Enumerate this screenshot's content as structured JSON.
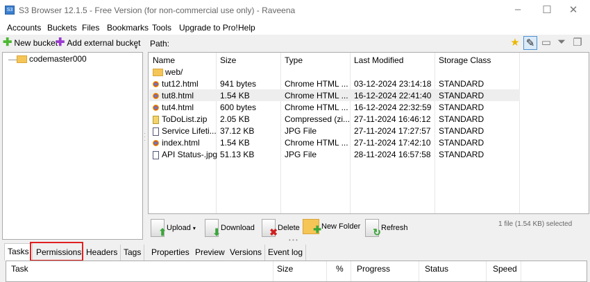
{
  "window": {
    "title": "S3 Browser 12.1.5 - Free Version (for non-commercial use only) - Raveena",
    "icon_text": "S3"
  },
  "menu": [
    "Accounts",
    "Buckets",
    "Files",
    "Bookmarks",
    "Tools",
    "Upgrade to Pro!",
    "Help"
  ],
  "left_toolbar": {
    "new_bucket": "New bucket",
    "add_external": "Add external bucket"
  },
  "path_label": "Path:",
  "tree": {
    "bucket": "codemaster000"
  },
  "columns": [
    "Name",
    "Size",
    "Type",
    "Last Modified",
    "Storage Class"
  ],
  "files": [
    {
      "name": "web/",
      "size": "",
      "type": "",
      "modified": "",
      "storage": "",
      "icon": "folder"
    },
    {
      "name": "tut12.html",
      "size": "941 bytes",
      "type": "Chrome HTML ...",
      "modified": "03-12-2024 23:14:18",
      "storage": "STANDARD",
      "icon": "chrome"
    },
    {
      "name": "tut8.html",
      "size": "1.54 KB",
      "type": "Chrome HTML ...",
      "modified": "16-12-2024 22:41:40",
      "storage": "STANDARD",
      "icon": "chrome",
      "selected": true
    },
    {
      "name": "tut4.html",
      "size": "600 bytes",
      "type": "Chrome HTML ...",
      "modified": "16-12-2024 22:32:59",
      "storage": "STANDARD",
      "icon": "chrome"
    },
    {
      "name": "ToDoList.zip",
      "size": "2.05 KB",
      "type": "Compressed (zi...",
      "modified": "27-11-2024 16:46:12",
      "storage": "STANDARD",
      "icon": "zip"
    },
    {
      "name": "Service Lifeti...",
      "size": "37.12 KB",
      "type": "JPG File",
      "modified": "27-11-2024 17:27:57",
      "storage": "STANDARD",
      "icon": "jpg"
    },
    {
      "name": "index.html",
      "size": "1.54 KB",
      "type": "Chrome HTML ...",
      "modified": "27-11-2024 17:42:10",
      "storage": "STANDARD",
      "icon": "chrome"
    },
    {
      "name": "API Status-.jpg",
      "size": "51.13 KB",
      "type": "JPG File",
      "modified": "28-11-2024 16:57:58",
      "storage": "STANDARD",
      "icon": "jpg"
    }
  ],
  "actions": {
    "upload": "Upload",
    "download": "Download",
    "delete": "Delete",
    "new_folder": "New Folder",
    "refresh": "Refresh"
  },
  "status": "1 file (1.54 KB) selected",
  "tabs": [
    "Tasks",
    "Permissions",
    "Headers",
    "Tags",
    "Properties",
    "Preview",
    "Versions",
    "Event log"
  ],
  "highlight_color": "#e02020",
  "task_columns": [
    "Task",
    "Size",
    "%",
    "Progress",
    "Status",
    "Speed"
  ]
}
